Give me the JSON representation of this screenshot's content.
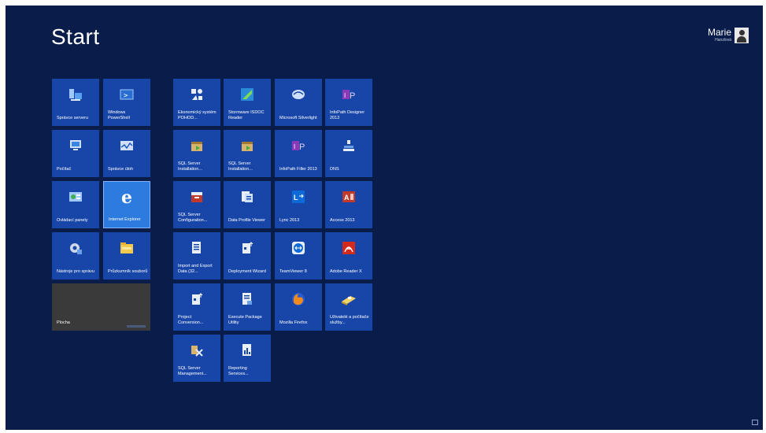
{
  "header": {
    "title": "Start"
  },
  "user": {
    "name": "Marie",
    "subtitle": "Hanzlová"
  },
  "tiles": [
    {
      "label": "Správce serveru",
      "icon": "server-manager-icon"
    },
    {
      "label": "Windows PowerShell",
      "icon": "powershell-icon"
    },
    {
      "label": "Počítač",
      "icon": "computer-icon"
    },
    {
      "label": "Správce úloh",
      "icon": "task-manager-icon"
    },
    {
      "label": "Ovládací panely",
      "icon": "control-panel-icon"
    },
    {
      "label": "Internet Explorer",
      "icon": "internet-explorer-icon"
    },
    {
      "label": "Nástroje pro správu",
      "icon": "admin-tools-icon"
    },
    {
      "label": "Průzkumník souborů",
      "icon": "file-explorer-icon"
    },
    {
      "label": "Plocha",
      "icon": "desktop-icon"
    },
    {
      "label": "Ekonomický systém POHOD...",
      "icon": "pohoda-icon"
    },
    {
      "label": "Stormware ISDOC Reader",
      "icon": "isdoc-reader-icon"
    },
    {
      "label": "Microsoft Silverlight",
      "icon": "silverlight-icon"
    },
    {
      "label": "InfoPath Designer 2013",
      "icon": "infopath-designer-icon"
    },
    {
      "label": "SQL Server Installation...",
      "icon": "sql-installation-icon"
    },
    {
      "label": "SQL Server Installation...",
      "icon": "sql-installation-icon"
    },
    {
      "label": "InfoPath Filler 2013",
      "icon": "infopath-filler-icon"
    },
    {
      "label": "DNS",
      "icon": "dns-icon"
    },
    {
      "label": "SQL Server Configuration...",
      "icon": "sql-configuration-icon"
    },
    {
      "label": "Data Profile Viewer",
      "icon": "data-profile-viewer-icon"
    },
    {
      "label": "Lync 2013",
      "icon": "lync-icon"
    },
    {
      "label": "Access 2013",
      "icon": "access-icon"
    },
    {
      "label": "Import and Export Data (32...",
      "icon": "import-export-icon"
    },
    {
      "label": "Deployment Wizard",
      "icon": "deployment-wizard-icon"
    },
    {
      "label": "TeamViewer 8",
      "icon": "teamviewer-icon"
    },
    {
      "label": "Adobe Reader X",
      "icon": "adobe-reader-icon"
    },
    {
      "label": "Project Conversion...",
      "icon": "project-conversion-icon"
    },
    {
      "label": "Execute Package Utility",
      "icon": "execute-package-icon"
    },
    {
      "label": "Mozilla Firefox",
      "icon": "firefox-icon"
    },
    {
      "label": "Uživatelé a počítače služby...",
      "icon": "users-computers-icon"
    },
    {
      "label": "SQL Server Management...",
      "icon": "sql-management-icon"
    },
    {
      "label": "Reporting Services...",
      "icon": "reporting-services-icon"
    }
  ]
}
